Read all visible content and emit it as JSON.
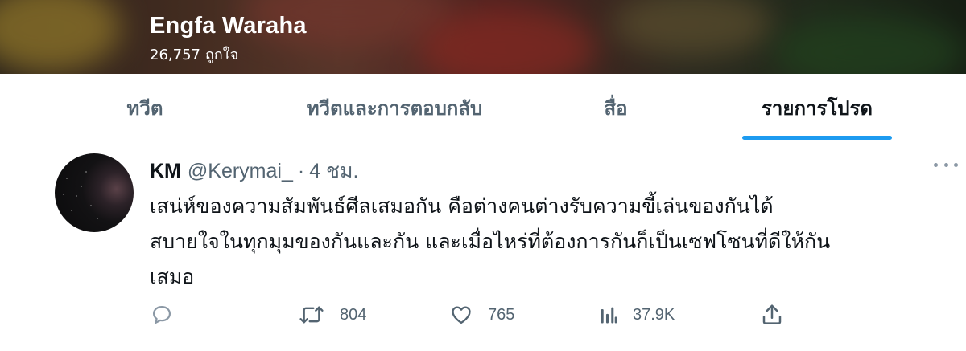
{
  "profile": {
    "name": "Engfa Waraha",
    "likes_count": "26,757",
    "likes_label": "ถูกใจ"
  },
  "tabs": [
    {
      "label": "ทวีต",
      "active": false
    },
    {
      "label": "ทวีตและการตอบกลับ",
      "active": false
    },
    {
      "label": "สื่อ",
      "active": false
    },
    {
      "label": "รายการโปรด",
      "active": true
    }
  ],
  "tweet": {
    "author_name": "KM",
    "author_handle": "@Kerymai_",
    "separator": "·",
    "time": "4 ชม.",
    "text": "เสน่ห์ของความสัมพันธ์ศีลเสมอกัน คือต่างคนต่างรับความขี้เล่นของกันได้\nสบายใจในทุกมุมของกันและกัน และเมื่อไหร่ที่ต้องการกันก็เป็นเซฟโซนที่ดีให้กัน\nเสมอ",
    "actions": {
      "reply": {
        "icon": "reply-icon",
        "count": ""
      },
      "retweet": {
        "icon": "retweet-icon",
        "count": "804"
      },
      "like": {
        "icon": "heart-icon",
        "count": "765"
      },
      "views": {
        "icon": "views-icon",
        "count": "37.9K"
      },
      "share": {
        "icon": "share-icon"
      }
    }
  },
  "colors": {
    "accent": "#1d9bf0",
    "text_primary": "#0f1419",
    "text_secondary": "#536471",
    "divider": "#e7e9ea"
  }
}
